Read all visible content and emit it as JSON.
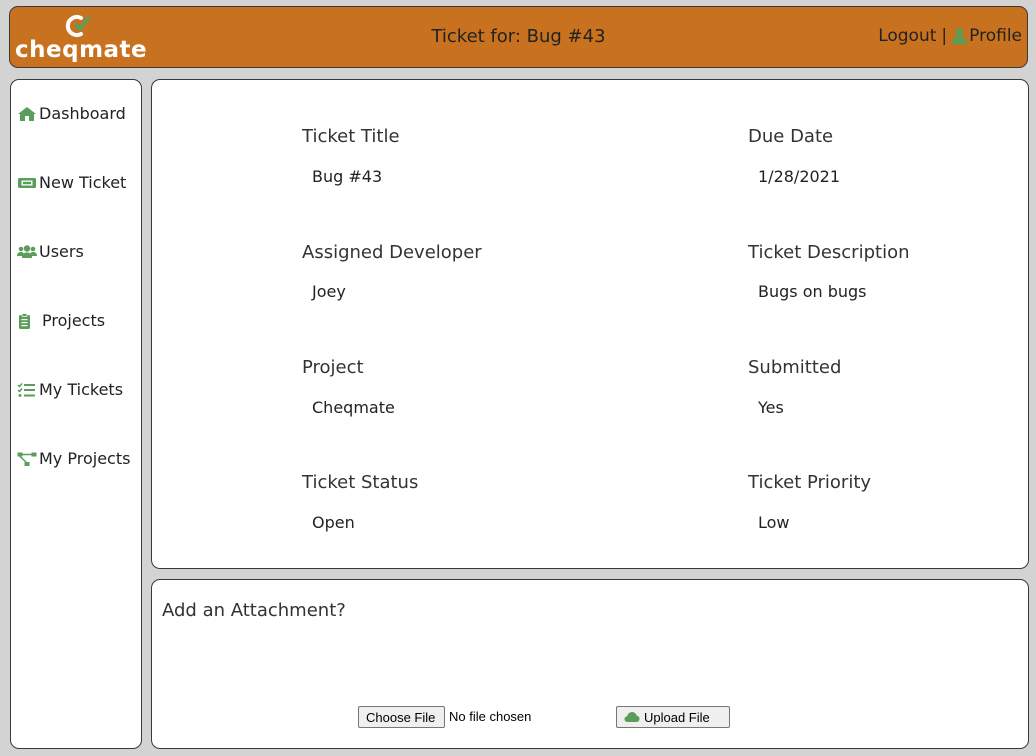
{
  "header": {
    "logo_text": "cheqmate",
    "title": "Ticket for: Bug #43",
    "logout_label": "Logout",
    "separator": "|",
    "profile_label": "Profile"
  },
  "sidebar": {
    "items": [
      {
        "label": "Dashboard",
        "icon": "home-icon"
      },
      {
        "label": "New Ticket",
        "icon": "ticket-icon"
      },
      {
        "label": "Users",
        "icon": "users-icon"
      },
      {
        "label": "Projects",
        "icon": "clipboard-icon"
      },
      {
        "label": "My Tickets",
        "icon": "tasks-icon"
      },
      {
        "label": "My Projects",
        "icon": "project-diagram-icon"
      }
    ]
  },
  "ticket": {
    "title_label": "Ticket Title",
    "title_value": "Bug #43",
    "due_date_label": "Due Date",
    "due_date_value": "1/28/2021",
    "developer_label": "Assigned Developer",
    "developer_value": "Joey",
    "description_label": "Ticket Description",
    "description_value": "Bugs on bugs",
    "project_label": "Project",
    "project_value": "Cheqmate",
    "submitted_label": "Submitted",
    "submitted_value": "Yes",
    "status_label": "Ticket Status",
    "status_value": "Open",
    "priority_label": "Ticket Priority",
    "priority_value": "Low"
  },
  "attachment": {
    "title": "Add an Attachment?",
    "choose_file_label": "Choose File",
    "file_status": "No file chosen",
    "upload_label": "Upload File"
  },
  "colors": {
    "header_bg": "#c8721f",
    "icon_green": "#5a9e5a",
    "page_bg": "#d3d3d3"
  }
}
